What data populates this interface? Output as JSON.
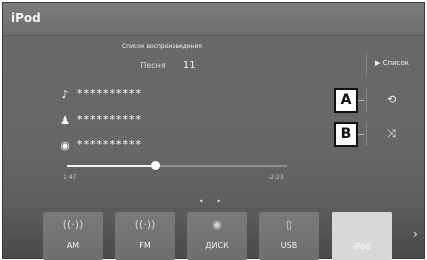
{
  "app": {
    "title": "iPod"
  },
  "now_playing": {
    "playlist_label": "Список воспроизведения",
    "song_label": "Песня",
    "song_number": "11",
    "rows": [
      {
        "icon": "♪",
        "icon_name": "music-note-icon",
        "text": "**********"
      },
      {
        "icon": "♟",
        "icon_name": "artist-icon",
        "text": "**********"
      },
      {
        "icon": "◉",
        "icon_name": "album-icon",
        "text": "**********"
      }
    ],
    "progress_fraction": 0.4,
    "elapsed": "1:47",
    "remaining": "-2:23"
  },
  "side_buttons": {
    "source_label": "Список",
    "source_icon": "▶",
    "repeat_icon": "⟲",
    "shuffle_icon": "⤨"
  },
  "callouts": {
    "a": "A",
    "b": "B"
  },
  "page_dots": "• •",
  "sources": [
    {
      "label": "AM",
      "icon": "((·))",
      "icon_name": "am-radio-icon"
    },
    {
      "label": "FM",
      "icon": "((·))",
      "icon_name": "fm-radio-icon"
    },
    {
      "label": "ДИСК",
      "icon": "◉",
      "icon_name": "disc-icon"
    },
    {
      "label": "USB",
      "icon": "▯",
      "icon_name": "usb-icon"
    },
    {
      "label": "iPod",
      "icon": "",
      "icon_name": "ipod-icon"
    }
  ],
  "next_page_icon": "›"
}
